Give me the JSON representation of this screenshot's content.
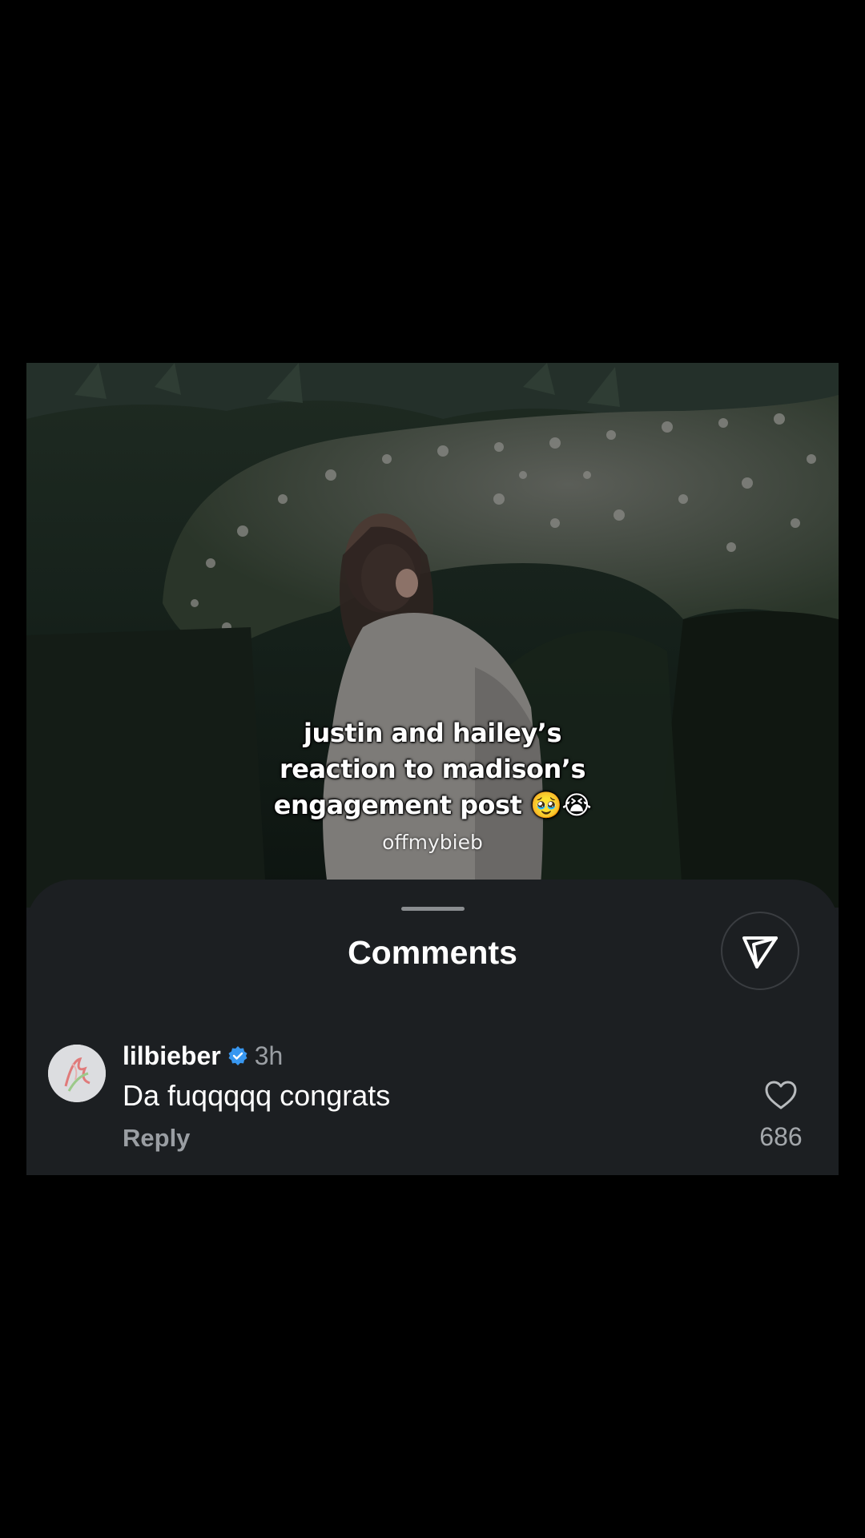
{
  "post": {
    "caption_lines": [
      "justin and hailey’s",
      "reaction to madison’s",
      "engagement post 🥹😭"
    ],
    "watermark": "offmybieb"
  },
  "comments_sheet": {
    "title": "Comments",
    "share_icon": "send-icon"
  },
  "comment": {
    "username": "lilbieber",
    "verified_icon": "verified-badge-icon",
    "time": "3h",
    "text": "Da fuqqqqq congrats",
    "reply_label": "Reply",
    "like_icon": "heart-outline-icon",
    "like_count": "686"
  },
  "colors": {
    "background": "#000000",
    "sheet": "#1c1f22",
    "verified": "#3897f0",
    "secondary_text": "#9a9ea3"
  }
}
